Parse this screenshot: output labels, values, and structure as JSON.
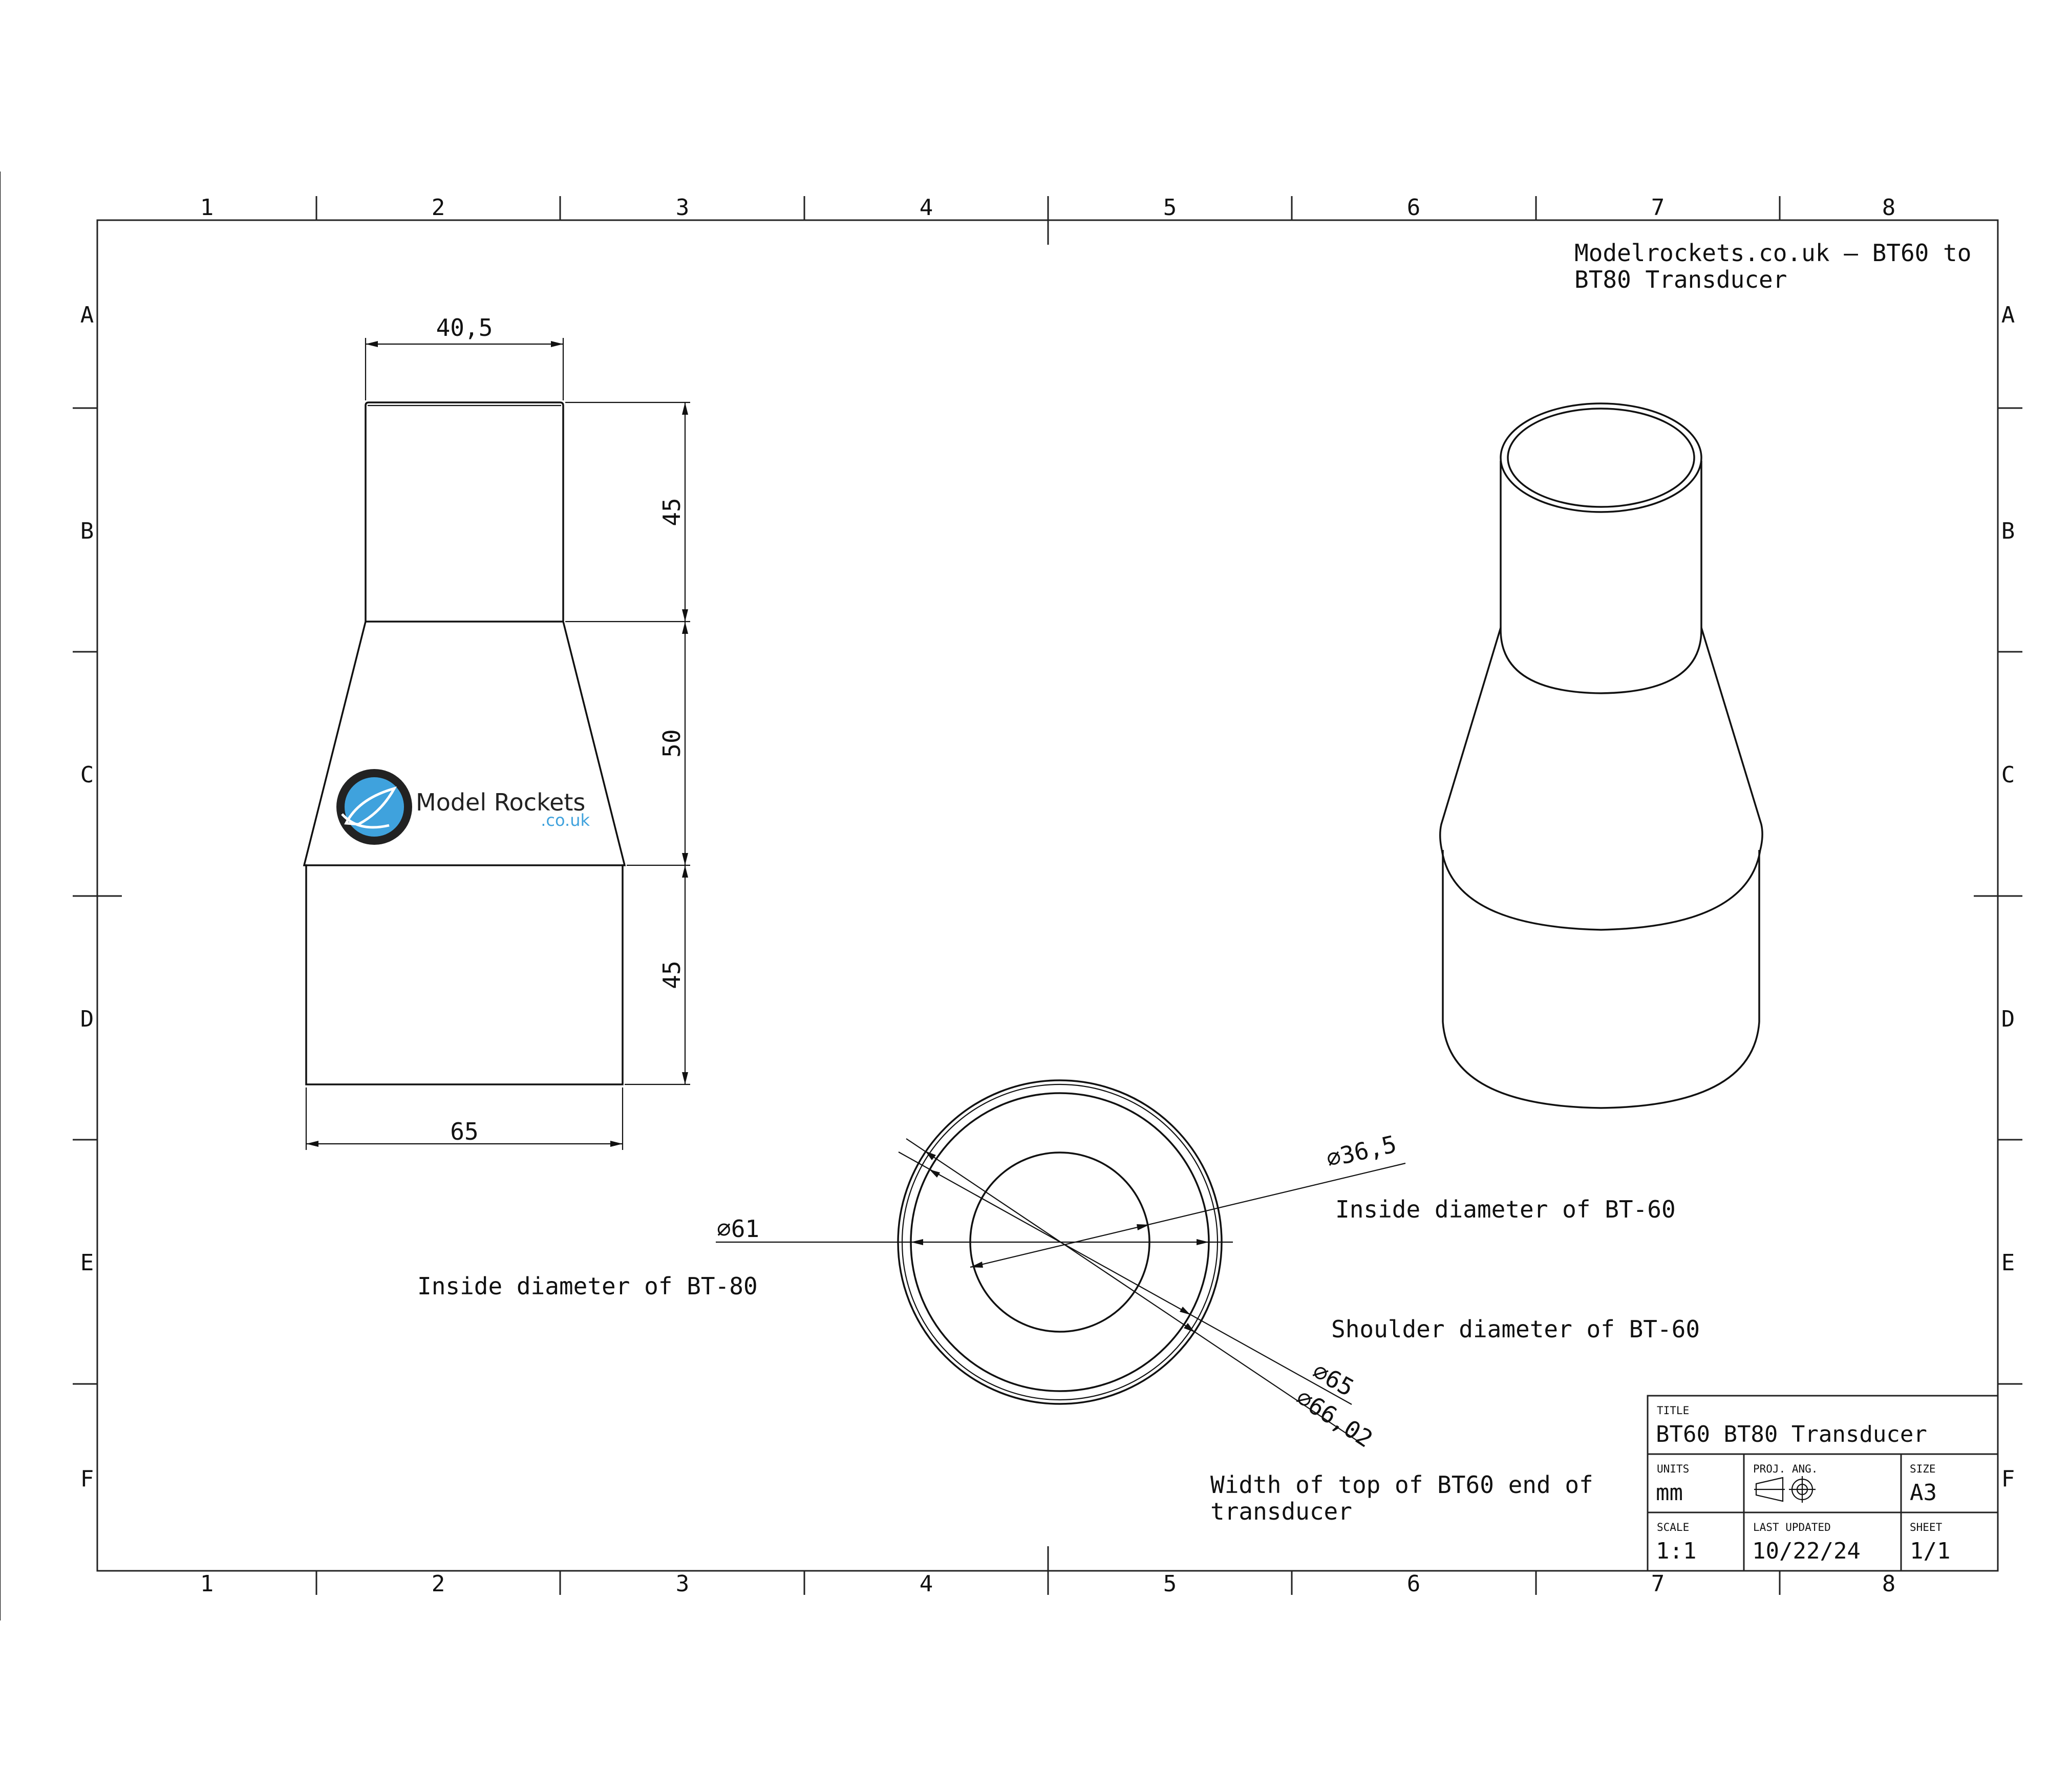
{
  "sheet": {
    "header_note": [
      "Modelrockets.co.uk – BT60 to",
      "BT80 Transducer"
    ],
    "zones_cols": [
      "1",
      "2",
      "3",
      "4",
      "5",
      "6",
      "7",
      "8"
    ],
    "zones_rows": [
      "A",
      "B",
      "C",
      "D",
      "E",
      "F"
    ]
  },
  "front_view": {
    "dims": {
      "top_width": "40,5",
      "top_height": "45",
      "cone_height": "50",
      "bottom_height": "45",
      "bottom_width": "65"
    },
    "logo": {
      "name": "Model Rockets",
      "domain": ".co.uk"
    }
  },
  "top_view": {
    "dims": {
      "d61": "⌀61",
      "d36": "⌀36,5",
      "d65": "⌀65",
      "d66": "⌀66,02"
    },
    "notes": {
      "bt80_inside": "Inside diameter of BT-80",
      "bt60_inside": "Inside diameter of BT-60",
      "bt60_shoulder": "Shoulder diameter of BT-60",
      "top_width": [
        "Width of top of BT60 end of",
        "transducer"
      ]
    }
  },
  "title_block": {
    "title_label": "TITLE",
    "title": "BT60 BT80 Transducer",
    "units_label": "UNITS",
    "units": "mm",
    "proj_label": "PROJ. ANG.",
    "size_label": "SIZE",
    "size": "A3",
    "scale_label": "SCALE",
    "scale": "1:1",
    "updated_label": "LAST UPDATED",
    "updated": "10/22/24",
    "sheet_label": "SHEET",
    "sheet": "1/1"
  },
  "colors": {
    "line": "#111111",
    "logo_blue": "#3fa2dd",
    "logo_ring": "#222222"
  }
}
